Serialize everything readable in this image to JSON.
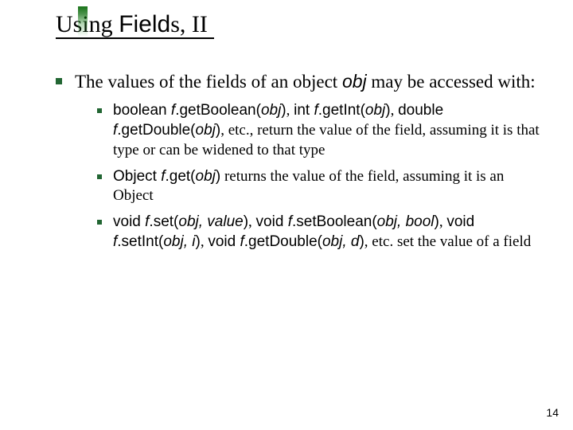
{
  "title": {
    "part1": "Using ",
    "part2_sans": "Field",
    "part3": "s, II"
  },
  "intro": {
    "pre": "The values of the fields of an object ",
    "obj": "obj",
    "post": " may be accessed with:"
  },
  "items": [
    {
      "segs": [
        {
          "t": "boolean ",
          "c": "sans"
        },
        {
          "t": "f",
          "c": "sans ital"
        },
        {
          "t": ".getBoolean(",
          "c": "sans"
        },
        {
          "t": "obj",
          "c": "sans ital"
        },
        {
          "t": ")",
          "c": "sans"
        },
        {
          "t": ", ",
          "c": ""
        },
        {
          "t": "int ",
          "c": "sans"
        },
        {
          "t": "f",
          "c": "sans ital"
        },
        {
          "t": ".getInt(",
          "c": "sans"
        },
        {
          "t": "obj",
          "c": "sans ital"
        },
        {
          "t": ")",
          "c": "sans"
        },
        {
          "t": ", ",
          "c": ""
        },
        {
          "t": "double ",
          "c": "sans"
        },
        {
          "t": "f",
          "c": "sans ital"
        },
        {
          "t": ".getDouble(",
          "c": "sans"
        },
        {
          "t": "obj",
          "c": "sans ital"
        },
        {
          "t": ")",
          "c": "sans"
        },
        {
          "t": ", etc., return the value of the field, assuming it is that type or can be widened to that type",
          "c": ""
        }
      ]
    },
    {
      "segs": [
        {
          "t": "Object ",
          "c": "sans"
        },
        {
          "t": "f",
          "c": "sans ital"
        },
        {
          "t": ".get(",
          "c": "sans"
        },
        {
          "t": "obj",
          "c": "sans ital"
        },
        {
          "t": ")",
          "c": "sans"
        },
        {
          "t": " returns the value of the field, assuming it is an Object",
          "c": ""
        }
      ]
    },
    {
      "segs": [
        {
          "t": "void ",
          "c": "sans"
        },
        {
          "t": "f",
          "c": "sans ital"
        },
        {
          "t": ".set(",
          "c": "sans"
        },
        {
          "t": "obj, value",
          "c": "sans ital"
        },
        {
          "t": ")",
          "c": "sans"
        },
        {
          "t": ", ",
          "c": ""
        },
        {
          "t": "void ",
          "c": "sans"
        },
        {
          "t": "f",
          "c": "sans ital"
        },
        {
          "t": ".setBoolean(",
          "c": "sans"
        },
        {
          "t": "obj, bool",
          "c": "sans ital"
        },
        {
          "t": ")",
          "c": "sans"
        },
        {
          "t": ", ",
          "c": ""
        },
        {
          "t": "void ",
          "c": "sans"
        },
        {
          "t": "f",
          "c": "sans ital"
        },
        {
          "t": ".setInt(",
          "c": "sans"
        },
        {
          "t": "obj, i",
          "c": "sans ital"
        },
        {
          "t": ")",
          "c": "sans"
        },
        {
          "t": ", ",
          "c": ""
        },
        {
          "t": "void ",
          "c": "sans"
        },
        {
          "t": "f",
          "c": "sans ital"
        },
        {
          "t": ".getDouble(",
          "c": "sans"
        },
        {
          "t": "obj, d",
          "c": "sans ital"
        },
        {
          "t": ")",
          "c": "sans"
        },
        {
          "t": ", etc. set the value of a field",
          "c": ""
        }
      ]
    }
  ],
  "page_number": "14"
}
